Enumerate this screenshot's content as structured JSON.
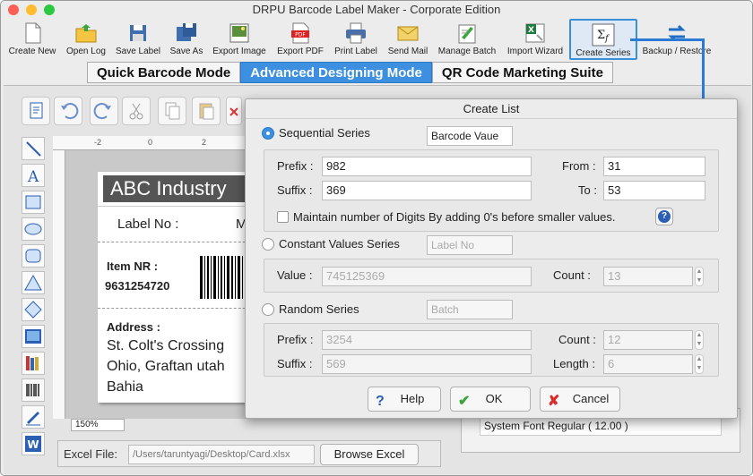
{
  "window": {
    "title": "DRPU Barcode Label Maker - Corporate Edition"
  },
  "toolbar": {
    "items": [
      {
        "label": "Create New",
        "icon": "create-new-icon"
      },
      {
        "label": "Open Log",
        "icon": "open-folder-icon"
      },
      {
        "label": "Save Label",
        "icon": "save-icon"
      },
      {
        "label": "Save As",
        "icon": "save-as-icon"
      },
      {
        "label": "Export Image",
        "icon": "export-image-icon"
      },
      {
        "label": "Export PDF",
        "icon": "pdf-icon"
      },
      {
        "label": "Print Label",
        "icon": "printer-icon"
      },
      {
        "label": "Send Mail",
        "icon": "mail-icon"
      },
      {
        "label": "Manage Batch",
        "icon": "batch-icon"
      },
      {
        "label": "Import Wizard",
        "icon": "import-wizard-icon"
      },
      {
        "label": "Create Series",
        "icon": "sigma-fx-icon"
      },
      {
        "label": "Backup / Restore",
        "icon": "backup-restore-icon"
      }
    ]
  },
  "modes": {
    "quick": "Quick Barcode Mode",
    "advanced": "Advanced Designing Mode",
    "qr": "QR Code Marketing Suite"
  },
  "ruler": {
    "ticks": [
      "-2",
      "0",
      "2"
    ]
  },
  "card": {
    "header": "ABC Industry",
    "label_no": "Label No :",
    "label_no_cut": "M",
    "item_nr_label": "Item NR :",
    "item_nr_value": "9631254720",
    "address_label": "Address :",
    "address_lines": [
      "St. Colt's Crossing",
      "Ohio, Graftan utah",
      "Bahia"
    ]
  },
  "zoom": {
    "value": "150%"
  },
  "excel": {
    "label": "Excel File:",
    "path": "/Users/taruntyagi/Desktop/Card.xlsx",
    "browse": "Browse Excel"
  },
  "font_panel": {
    "value": "System Font Regular ( 12.00 )"
  },
  "dialog": {
    "title": "Create List",
    "sequential": {
      "label": "Sequential Series",
      "tag": "Barcode Vaue",
      "prefix_label": "Prefix :",
      "prefix": "982",
      "suffix_label": "Suffix :",
      "suffix": "369",
      "from_label": "From :",
      "from": "31",
      "to_label": "To :",
      "to": "53",
      "maintain_label": "Maintain number of Digits By adding 0's before smaller values.",
      "maintain_checked": false
    },
    "constant": {
      "label": "Constant Values Series",
      "tag": "Label No",
      "value_label": "Value :",
      "value": "745125369",
      "count_label": "Count :",
      "count": "13"
    },
    "random": {
      "label": "Random Series",
      "tag": "Batch",
      "prefix_label": "Prefix :",
      "prefix": "3254",
      "suffix_label": "Suffix :",
      "suffix": "569",
      "count_label": "Count :",
      "count": "12",
      "length_label": "Length :",
      "length": "6"
    },
    "buttons": {
      "help": "Help",
      "ok": "OK",
      "cancel": "Cancel"
    }
  },
  "colors": {
    "accent": "#3d90df",
    "arrow": "#2b7bd6",
    "cancel_x": "#d92b2b",
    "ok_check": "#3aa63a"
  }
}
